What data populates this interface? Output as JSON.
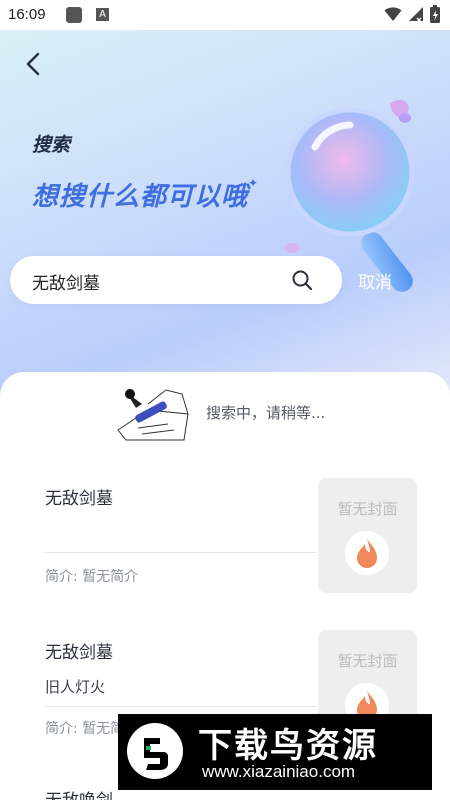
{
  "status_bar": {
    "time": "16:09",
    "a_glyph": "A"
  },
  "header": {
    "heading_small": "搜索",
    "heading_big": "想搜什么都可以哦",
    "sparkle": "✦"
  },
  "search": {
    "value": "无敌剑墓",
    "cancel_label": "取消"
  },
  "loading": {
    "text": "搜索中，请稍等..."
  },
  "results": [
    {
      "title": "无敌剑墓",
      "author": "",
      "intro": "简介: 暂无简介",
      "cover_text": "暂无封面"
    },
    {
      "title": "无敌剑墓",
      "author": "旧人灯火",
      "intro": "简介: 暂无简介",
      "cover_text": "暂无封面"
    },
    {
      "title": "无敌唤剑"
    }
  ],
  "watermark": {
    "title": "下载鸟资源",
    "url": "www.xiazainiao.com"
  },
  "colors": {
    "accent": "#3f6ee0",
    "brand_orange": "#f08a5d"
  }
}
